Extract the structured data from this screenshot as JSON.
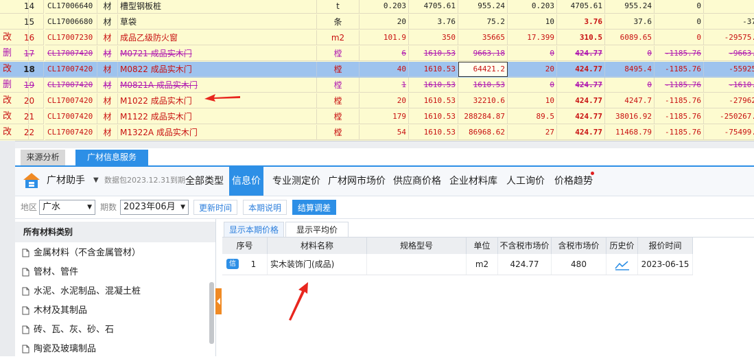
{
  "grid": {
    "rows": [
      {
        "mark": "",
        "no": "14",
        "code": "CL17006640",
        "type": "材",
        "name": "槽型钢板桩",
        "unit": "t",
        "v1": "0.203",
        "v2": "4705.61",
        "v3": "955.24",
        "v4": "0.203",
        "v5": "4705.61",
        "v6": "955.24",
        "v7": "0",
        "v8": ""
      },
      {
        "mark": "",
        "no": "15",
        "code": "CL17006680",
        "type": "材",
        "name": "草袋",
        "unit": "条",
        "v1": "20",
        "v2": "3.76",
        "v3": "75.2",
        "v4": "10",
        "v5": "3.76",
        "v6": "37.6",
        "v7": "0",
        "v8": "-37"
      },
      {
        "mark": "改",
        "no": "16",
        "code": "CL17007230",
        "type": "材",
        "name": "成品乙级防火窗",
        "unit": "m2",
        "v1": "101.9",
        "v2": "350",
        "v3": "35665",
        "v4": "17.399",
        "v5": "310.5",
        "v6": "6089.65",
        "v7": "0",
        "v8": "-29575."
      },
      {
        "mark": "删",
        "no": "17",
        "code": "CL17007420",
        "type": "材",
        "name": "M0721 成品实木门",
        "unit": "樘",
        "v1": "6",
        "v2": "1610.53",
        "v3": "9663.18",
        "v4": "0",
        "v5": "424.77",
        "v6": "0",
        "v7": "-1185.76",
        "v8": "-9663."
      },
      {
        "mark": "改",
        "no": "18",
        "code": "CL17007420",
        "type": "材",
        "name": "M0822 成品实木门",
        "unit": "樘",
        "v1": "40",
        "v2": "1610.53",
        "v3": "64421.2",
        "v4": "20",
        "v5": "424.77",
        "v6": "8495.4",
        "v7": "-1185.76",
        "v8": "-55925"
      },
      {
        "mark": "删",
        "no": "19",
        "code": "CL17007420",
        "type": "材",
        "name": "M0821A 成品实木门",
        "unit": "樘",
        "v1": "1",
        "v2": "1610.53",
        "v3": "1610.53",
        "v4": "0",
        "v5": "424.77",
        "v6": "0",
        "v7": "-1185.76",
        "v8": "-1610."
      },
      {
        "mark": "改",
        "no": "20",
        "code": "CL17007420",
        "type": "材",
        "name": "M1022 成品实木门",
        "unit": "樘",
        "v1": "20",
        "v2": "1610.53",
        "v3": "32210.6",
        "v4": "10",
        "v5": "424.77",
        "v6": "4247.7",
        "v7": "-1185.76",
        "v8": "-27962"
      },
      {
        "mark": "改",
        "no": "21",
        "code": "CL17007420",
        "type": "材",
        "name": "M1122 成品实木门",
        "unit": "樘",
        "v1": "179",
        "v2": "1610.53",
        "v3": "288284.87",
        "v4": "89.5",
        "v5": "424.77",
        "v6": "38016.92",
        "v7": "-1185.76",
        "v8": "-250267."
      },
      {
        "mark": "改",
        "no": "22",
        "code": "CL17007420",
        "type": "材",
        "name": "M1322A 成品实木门",
        "unit": "樘",
        "v1": "54",
        "v2": "1610.53",
        "v3": "86968.62",
        "v4": "27",
        "v5": "424.77",
        "v6": "11468.79",
        "v7": "-1185.76",
        "v8": "-75499."
      }
    ]
  },
  "tabs": {
    "source_analysis": "来源分析",
    "gc_info": "广材信息服务"
  },
  "header": {
    "brand": "广材助手",
    "package": "数据包2023.12.31到期",
    "nav": [
      "全部类型",
      "信息价",
      "专业测定价",
      "广材网市场价",
      "供应商价格",
      "企业材料库",
      "人工询价",
      "价格趋势"
    ]
  },
  "filter": {
    "region_label": "地区",
    "region_value": "广水",
    "period_label": "期数",
    "period_value": "2023年06月",
    "btn_refresh": "更新时间",
    "btn_notes": "本期说明",
    "btn_settle": "结算调差"
  },
  "categories": {
    "title": "所有材料类别",
    "items": [
      "金属材料（不含金属管材）",
      "管材、管件",
      "水泥、水泥制品、混凝土桩",
      "木材及其制品",
      "砖、瓦、灰、砂、石",
      "陶瓷及玻璃制品"
    ]
  },
  "results": {
    "subtab_current": "显示本期价格",
    "subtab_avg": "显示平均价",
    "columns": [
      "序号",
      "材料名称",
      "规格型号",
      "单位",
      "不含税市场价",
      "含税市场价",
      "历史价",
      "报价时间"
    ],
    "row": {
      "badge": "信",
      "no": "1",
      "name": "实木装饰门(成品)",
      "spec": "",
      "unit": "m2",
      "price_ex": "424.77",
      "price_in": "480",
      "date": "2023-06-15"
    }
  },
  "colors": {
    "accent": "#2d8fe6",
    "row_yellow": "#fdfbd0",
    "row_selected": "#9ec3ee",
    "mark_red": "#c81010",
    "mark_purple": "#b01ab0",
    "arrow_red": "#e8261e"
  }
}
